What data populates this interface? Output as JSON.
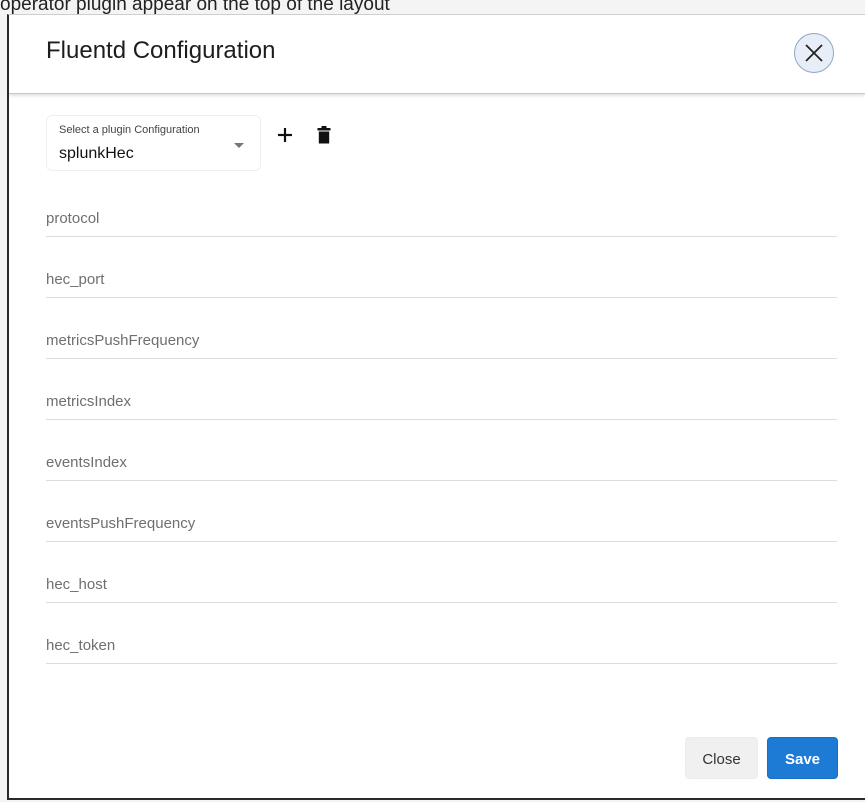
{
  "background": {
    "caption": "operator plugin appear on the top of the layout"
  },
  "modal": {
    "title": "Fluentd Configuration",
    "close_icon": "close-icon"
  },
  "plugin": {
    "label": "Select a plugin Configuration",
    "selected": "splunkHec",
    "add_icon": "plus-icon",
    "delete_icon": "trash-icon"
  },
  "fields": [
    {
      "placeholder": "protocol",
      "value": ""
    },
    {
      "placeholder": "hec_port",
      "value": ""
    },
    {
      "placeholder": "metricsPushFrequency",
      "value": ""
    },
    {
      "placeholder": "metricsIndex",
      "value": ""
    },
    {
      "placeholder": "eventsIndex",
      "value": ""
    },
    {
      "placeholder": "eventsPushFrequency",
      "value": ""
    },
    {
      "placeholder": "hec_host",
      "value": ""
    },
    {
      "placeholder": "hec_token",
      "value": ""
    }
  ],
  "footer": {
    "close_label": "Close",
    "save_label": "Save"
  },
  "colors": {
    "primary": "#1d7bd6",
    "secondary_button": "#f0f0f0"
  }
}
